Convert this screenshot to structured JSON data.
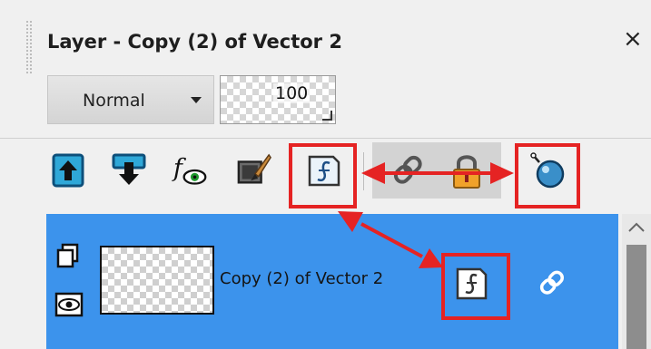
{
  "panel": {
    "title": "Layer - Copy (2) of Vector 2",
    "close_glyph": "×"
  },
  "blend_mode": {
    "value": "Normal",
    "icon": "dropdown-caret"
  },
  "opacity": {
    "value": "100"
  },
  "toolbar": {
    "icons": [
      "move-layer-up-icon",
      "move-layer-down-icon",
      "layer-effects-icon",
      "paint-brush-icon",
      "vector-layer-icon",
      "link-icon",
      "lock-icon",
      "clip-icon"
    ]
  },
  "layer": {
    "name": "Copy (2) of Vector 2",
    "icons": [
      "group-icon",
      "visibility-eye-icon",
      "vector-layer-icon",
      "link-icon"
    ]
  },
  "colors": {
    "selection": "#3c93ec",
    "highlight": "#e52323",
    "panel": "#f0f0f0"
  }
}
